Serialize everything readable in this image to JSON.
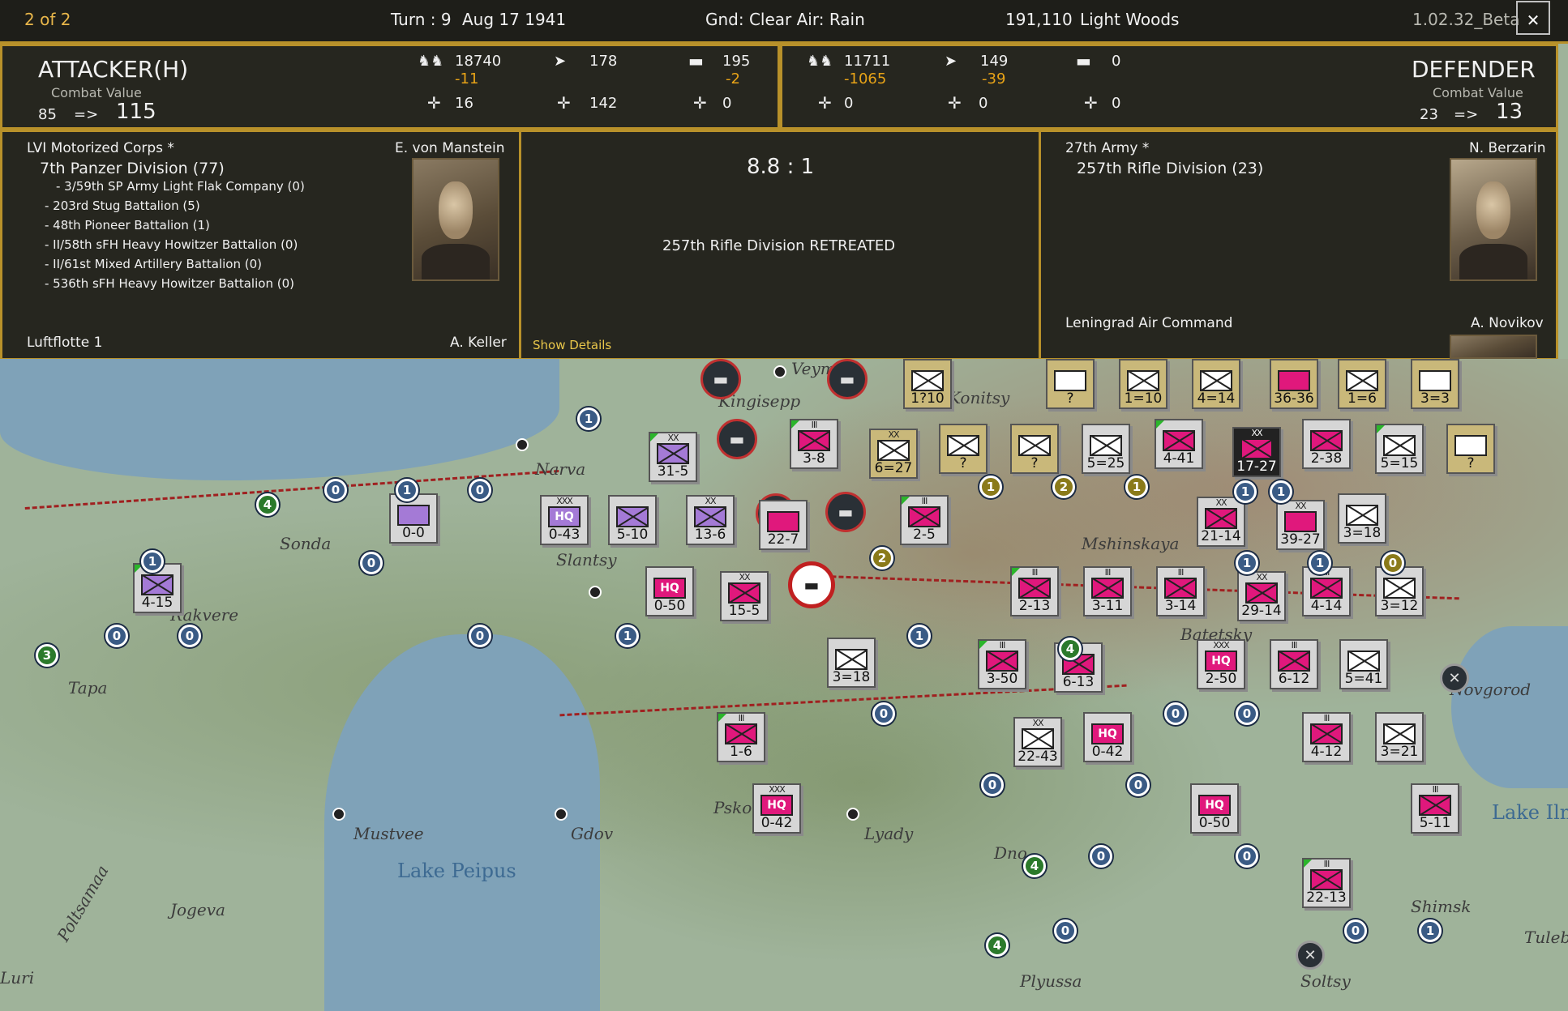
{
  "topbar": {
    "page": "2 of 2",
    "turn": "Turn : 9",
    "date": "Aug 17 1941",
    "weather": "Gnd: Clear  Air: Rain",
    "hex": "191,110",
    "terrain": "Light Woods",
    "version": "1.02.32_Beta",
    "close": "✕"
  },
  "attacker": {
    "title": "ATTACKER(H)",
    "cv_label": "Combat Value",
    "cv_before": "85",
    "cv_arrow": "=>",
    "cv_after": "115",
    "men": "18740",
    "men_loss": "-11",
    "guns": "178",
    "tanks": "195",
    "tanks_loss": "-2",
    "fighters": "16",
    "bombers": "142",
    "recon": "0"
  },
  "defender": {
    "title": "DEFENDER",
    "cv_label": "Combat Value",
    "cv_before": "23",
    "cv_arrow": "=>",
    "cv_after": "13",
    "men": "11711",
    "men_loss": "-1065",
    "guns": "149",
    "guns_loss": "-39",
    "tanks": "0",
    "fighters": "0",
    "bombers": "0",
    "recon": "0"
  },
  "att_units": {
    "corps": "LVI Motorized Corps *",
    "commander": "E. von Manstein",
    "division": "7th Panzer Division (77)",
    "attached": [
      "- 3/59th SP Army Light Flak Company (0)",
      "- 203rd Stug Battalion (5)",
      "- 48th Pioneer Battalion (1)",
      "- II/58th sFH Heavy Howitzer Battalion (0)",
      "- II/61st Mixed Artillery Battalion (0)",
      "- 536th sFH Heavy Howitzer Battalion (0)"
    ],
    "air": "Luftflotte 1",
    "air_commander": "A. Keller"
  },
  "result": {
    "odds": "8.8 : 1",
    "outcome": "257th Rifle Division RETREATED",
    "details": "Show Details"
  },
  "def_units": {
    "army": "27th Army *",
    "commander": "N. Berzarin",
    "division": "257th Rifle Division (23)",
    "air": "Leningrad Air Command",
    "air_commander": "A. Novikov"
  },
  "map": {
    "labels": [
      "Kingisepp",
      "Narva",
      "Sonda",
      "Slantsy",
      "Rakvere",
      "Tapa",
      "Mustvee",
      "Lake Peipus",
      "Gdov",
      "Lyady",
      "Jogeva",
      "Mshinskaya",
      "Novgorod",
      "Lake Ilmen",
      "Shimsk",
      "Soltsy",
      "Plyussa",
      "Dno",
      "Batetsky",
      "Tuleb",
      "Poltsamaa",
      "Veymarn",
      "Konitsy",
      "Luri",
      "Pskov"
    ],
    "units": [
      {
        "label": "31-5",
        "size": "XX"
      },
      {
        "label": "3-8",
        "size": "III"
      },
      {
        "label": "6=27",
        "size": "XX"
      },
      {
        "label": "?"
      },
      {
        "label": "?"
      },
      {
        "label": "5=25"
      },
      {
        "label": "4-41"
      },
      {
        "label": "17-27",
        "size": "XX"
      },
      {
        "label": "2-38"
      },
      {
        "label": "5=15"
      },
      {
        "label": "?"
      },
      {
        "label": "0-43",
        "size": "XXX"
      },
      {
        "label": "5-10"
      },
      {
        "label": "13-6",
        "size": "XX"
      },
      {
        "label": "22-7"
      },
      {
        "label": "2-5",
        "size": "III"
      },
      {
        "label": "0-0"
      },
      {
        "label": "4-15"
      },
      {
        "label": "0-50"
      },
      {
        "label": "15-5",
        "size": "XX"
      },
      {
        "label": "21-14",
        "size": "XX"
      },
      {
        "label": "39-27",
        "size": "XX"
      },
      {
        "label": "3=18"
      },
      {
        "label": "2-13",
        "size": "III"
      },
      {
        "label": "3-11",
        "size": "III"
      },
      {
        "label": "3-14",
        "size": "III"
      },
      {
        "label": "29-14",
        "size": "XX"
      },
      {
        "label": "4-14",
        "size": "III"
      },
      {
        "label": "3=12"
      },
      {
        "label": "3=18"
      },
      {
        "label": "3-50",
        "size": "III"
      },
      {
        "label": "6-13",
        "size": "III"
      },
      {
        "label": "2-50",
        "size": "XXX"
      },
      {
        "label": "6-12",
        "size": "III"
      },
      {
        "label": "5=41"
      },
      {
        "label": "1-6",
        "size": "III"
      },
      {
        "label": "22-43",
        "size": "XX"
      },
      {
        "label": "0-42"
      },
      {
        "label": "4-12",
        "size": "III"
      },
      {
        "label": "3=21"
      },
      {
        "label": "0-42",
        "size": "XXX"
      },
      {
        "label": "0-50"
      },
      {
        "label": "5-11",
        "size": "III"
      },
      {
        "label": "22-13",
        "size": "III"
      },
      {
        "label": "1?10"
      },
      {
        "label": "?"
      },
      {
        "label": "1=10"
      },
      {
        "label": "4=14"
      },
      {
        "label": "36-36"
      },
      {
        "label": "1=6"
      },
      {
        "label": "3=3"
      }
    ],
    "badges": [
      "1",
      "0",
      "2"
    ],
    "hq": "HQ",
    "stack_num": "4",
    "stack_num_b": "3"
  },
  "colors": {
    "accent": "#b8912a",
    "loss": "#e8a317",
    "german": "#e0187c",
    "soviet": "#c9b87a"
  },
  "icons": [
    "infantry-icon",
    "artillery-icon",
    "tank-icon",
    "fighter-icon",
    "bomber-icon",
    "recon-plane-icon",
    "close-icon"
  ]
}
